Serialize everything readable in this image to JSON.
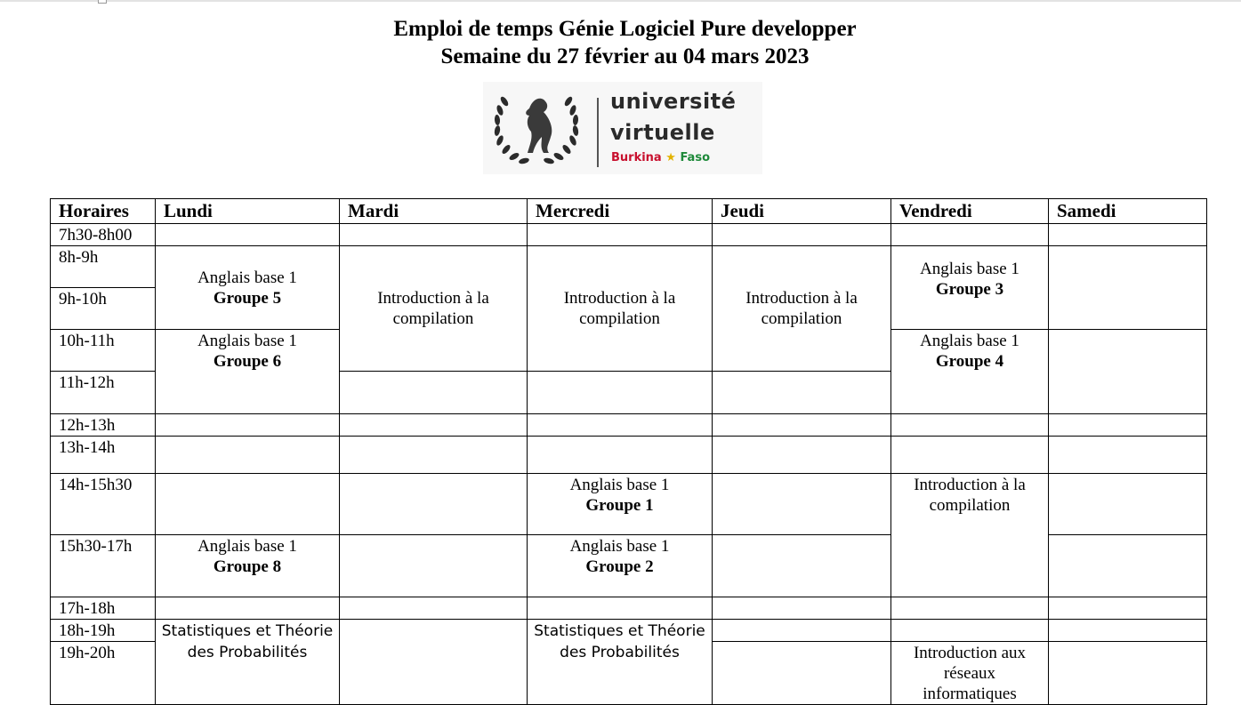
{
  "header": {
    "title_line1": "Emploi de temps Génie Logiciel Pure developper",
    "title_line2": "Semaine du 27 février au 04 mars 2023"
  },
  "logo": {
    "line1": "université",
    "line2": "virtuelle",
    "line3_part1": "Burkina",
    "line3_star": "★",
    "line3_part2": "Faso"
  },
  "timetable": {
    "columns": [
      "Horaires",
      "Lundi",
      "Mardi",
      "Mercredi",
      "Jeudi",
      "Vendredi",
      "Samedi"
    ],
    "times": [
      "7h30-8h00",
      "8h-9h",
      "9h-10h",
      "10h-11h",
      "11h-12h",
      "12h-13h",
      "13h-14h",
      "14h-15h30",
      "15h30-17h",
      "17h-18h",
      "18h-19h",
      "19h-20h"
    ],
    "courses": {
      "lundi_8h": {
        "name": "Anglais base 1",
        "group": "Groupe 5"
      },
      "lundi_10h": {
        "name": "Anglais base 1",
        "group": "Groupe 6"
      },
      "lundi_15h30": {
        "name": "Anglais base 1",
        "group": "Groupe 8"
      },
      "lundi_18h": {
        "line1": "Statistiques et Théorie",
        "line2": "des Probabilités"
      },
      "mardi_8h": {
        "line1": "Introduction à la",
        "line2": "compilation"
      },
      "mercredi_8h": {
        "line1": "Introduction à la",
        "line2": "compilation"
      },
      "mercredi_14h": {
        "name": "Anglais base 1",
        "group": "Groupe 1"
      },
      "mercredi_15h30": {
        "name": "Anglais base 1",
        "group": "Groupe 2"
      },
      "mercredi_18h": {
        "line1": "Statistiques et Théorie",
        "line2": "des Probabilités"
      },
      "jeudi_8h": {
        "line1": "Introduction à la",
        "line2": "compilation"
      },
      "vendredi_8h": {
        "name": "Anglais base 1",
        "group": "Groupe 3"
      },
      "vendredi_10h": {
        "name": "Anglais base 1",
        "group": "Groupe 4"
      },
      "vendredi_14h": {
        "line1": "Introduction à la",
        "line2": "compilation"
      },
      "vendredi_19h": {
        "line1": "Introduction aux",
        "line2": "réseaux",
        "line3": "informatiques"
      }
    }
  }
}
